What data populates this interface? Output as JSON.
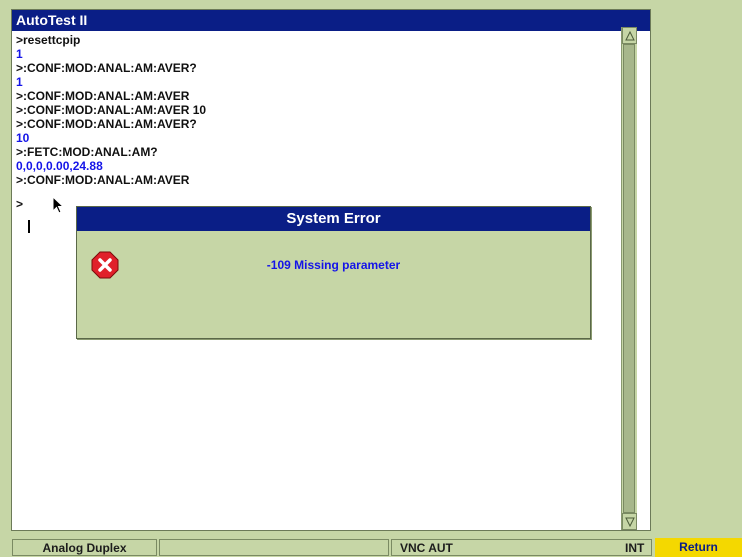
{
  "window": {
    "title": "AutoTest II"
  },
  "console": {
    "lines": [
      {
        "text": ">resettcpip",
        "kind": "command"
      },
      {
        "text": "1",
        "kind": "response"
      },
      {
        "text": ">:CONF:MOD:ANAL:AM:AVER?",
        "kind": "command"
      },
      {
        "text": "1",
        "kind": "response"
      },
      {
        "text": ">:CONF:MOD:ANAL:AM:AVER",
        "kind": "command"
      },
      {
        "text": ">:CONF:MOD:ANAL:AM:AVER 10",
        "kind": "command"
      },
      {
        "text": ">:CONF:MOD:ANAL:AM:AVER?",
        "kind": "command"
      },
      {
        "text": "10",
        "kind": "response"
      },
      {
        "text": ">:FETC:MOD:ANAL:AM?",
        "kind": "command"
      },
      {
        "text": "0,0,0,0.00,24.88",
        "kind": "response"
      },
      {
        "text": ">:CONF:MOD:ANAL:AM:AVER",
        "kind": "command"
      }
    ],
    "prompt": ">"
  },
  "dialog": {
    "title": "System Error",
    "icon": "error-stop-icon",
    "message": "-109 Missing parameter"
  },
  "status_bar": {
    "mode": "Analog Duplex",
    "connection": "VNC AUT",
    "reference": "INT",
    "return_label": "Return"
  },
  "colors": {
    "background": "#c6d6a6",
    "title_bar": "#0a1e86",
    "response_text": "#1414e8",
    "error_icon": "#e0202a",
    "return_key": "#f4d800"
  }
}
